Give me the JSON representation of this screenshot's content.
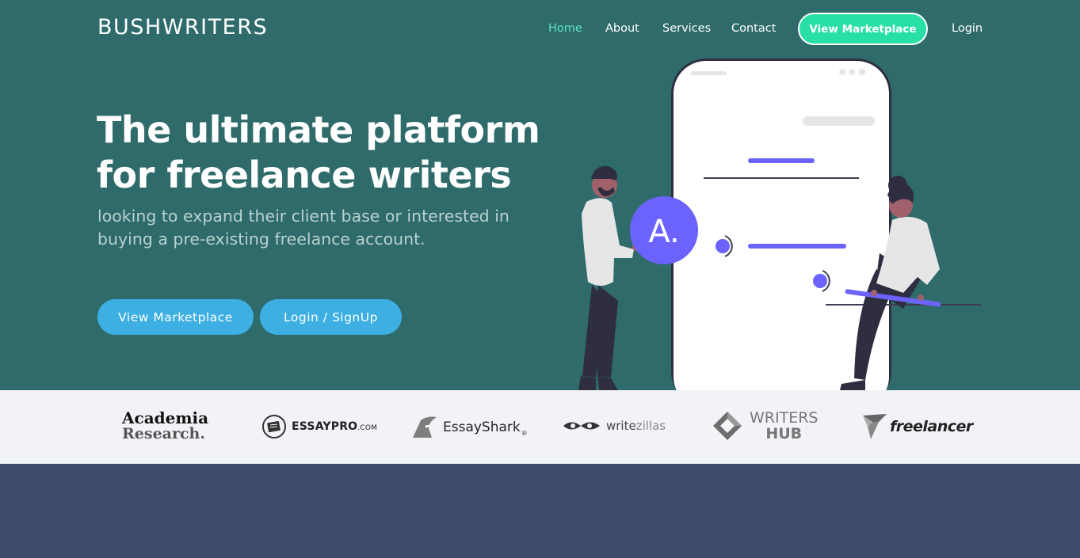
{
  "brand": "BUSHWRITERS",
  "nav": {
    "items": [
      {
        "label": "Home",
        "active": true
      },
      {
        "label": "About"
      },
      {
        "label": "Services"
      },
      {
        "label": "Contact"
      }
    ],
    "cta_label": "View Marketplace",
    "login_label": "Login"
  },
  "hero": {
    "title_line1": "The ultimate platform",
    "title_line2": "for freelance writers",
    "subtitle": "looking to expand their client base or interested in buying a pre-existing freelance account.",
    "buttons": {
      "marketplace": "View Marketplace",
      "login_signup": "Login / SignUp"
    },
    "badge_letter": "A."
  },
  "logos": {
    "academia_line1": "Academia",
    "academia_line2": "Research.",
    "essaypro": "ESSAYPRO",
    "essaypro_suffix": ".COM",
    "essayshark": "EssayShark",
    "writezillas_a": "write",
    "writezillas_b": "zillas",
    "writershub_line1": "WRITERS",
    "writershub_line2": "HUB",
    "freelancer": "freelancer"
  },
  "colors": {
    "hero_bg": "#2f6b6b",
    "nav_active": "#5ee5c2",
    "nav_cta_bg": "#28e0a6",
    "button_bg": "#3dafe3",
    "accent_purple": "#6c63ff",
    "logo_strip_bg": "#f1f3f7",
    "footer_bg": "#3e4c6a"
  }
}
